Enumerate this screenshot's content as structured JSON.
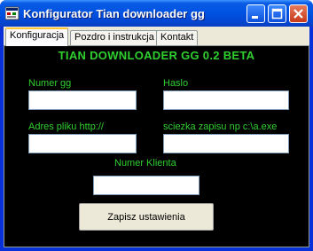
{
  "window": {
    "title": "Konfigurator Tian downloader gg",
    "app_icon": "app-icon",
    "controls": [
      "minimize-icon",
      "maximize-icon",
      "close-icon"
    ]
  },
  "tabs": [
    {
      "label": "Konfiguracja",
      "active": true
    },
    {
      "label": "Pozdro i instrukcja",
      "active": false
    },
    {
      "label": "Kontakt",
      "active": false
    }
  ],
  "panel": {
    "heading": "TIAN DOWNLOADER GG 0.2 BETA",
    "fields": {
      "numer_gg": {
        "label": "Numer gg",
        "value": ""
      },
      "haslo": {
        "label": "Haslo",
        "value": ""
      },
      "adres_pliku": {
        "label": "Adres pliku http://",
        "value": ""
      },
      "sciezka_zapisu": {
        "label": "sciezka zapisu np c:\\a.exe",
        "value": ""
      },
      "numer_klienta": {
        "label": "Numer Klienta",
        "value": ""
      }
    },
    "save_button": "Zapisz ustawienia"
  },
  "colors": {
    "label_green": "#2fd02f",
    "panel_bg": "#000000",
    "titlebar_blue": "#0054e3"
  }
}
